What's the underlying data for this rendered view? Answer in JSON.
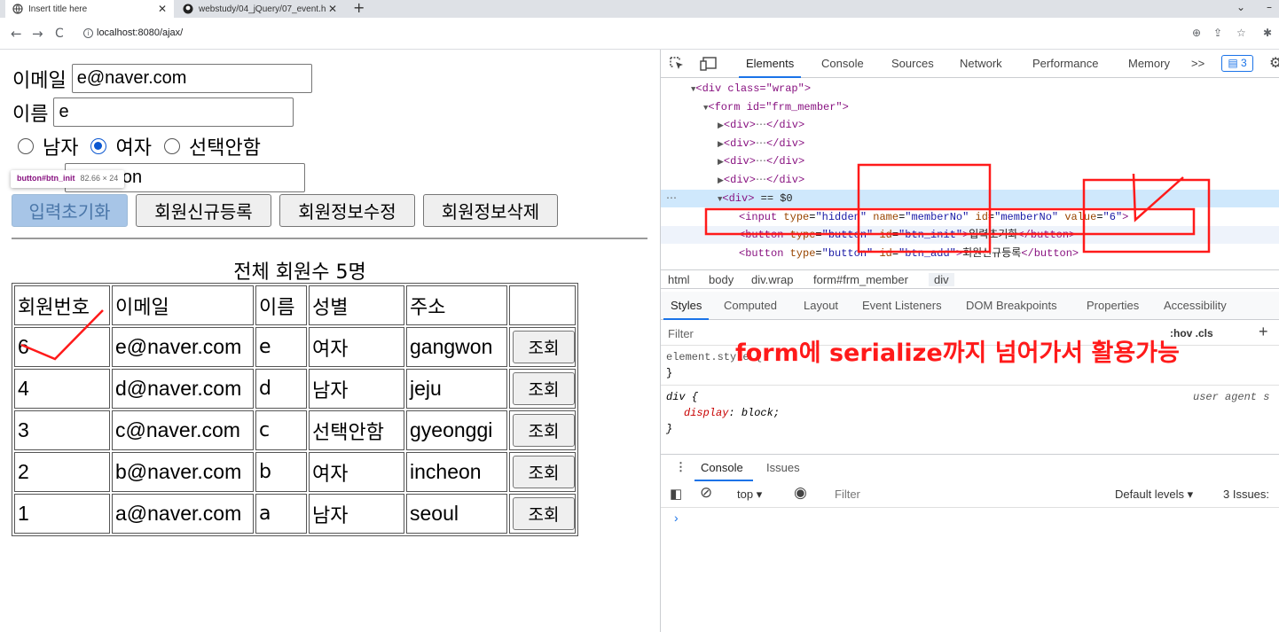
{
  "browser": {
    "tabs": [
      {
        "title": "Insert title here"
      },
      {
        "title": "webstudy/04_jQuery/07_event.h"
      }
    ],
    "new_tab": "+",
    "url": "localhost:8080/ajax/"
  },
  "form": {
    "email_label": "이메일",
    "email_value": "e@naver.com",
    "name_label": "이름",
    "name_value": "e",
    "genders": [
      "남자",
      "여자",
      "선택안함"
    ],
    "selected_gender": "여자",
    "address_value": "gangwon",
    "buttons": [
      "입력초기화",
      "회원신규등록",
      "회원정보수정",
      "회원정보삭제"
    ],
    "tooltip_selector": "button#btn_init",
    "tooltip_size": "82.66 × 24"
  },
  "table": {
    "caption": "전체 회원수 5명",
    "headers": [
      "회원번호",
      "이메일",
      "이름",
      "성별",
      "주소",
      ""
    ],
    "lookup_label": "조회",
    "rows": [
      [
        "6",
        "e@naver.com",
        "e",
        "여자",
        "gangwon"
      ],
      [
        "4",
        "d@naver.com",
        "d",
        "남자",
        "jeju"
      ],
      [
        "3",
        "c@naver.com",
        "c",
        "선택안함",
        "gyeonggi"
      ],
      [
        "2",
        "b@naver.com",
        "b",
        "여자",
        "incheon"
      ],
      [
        "1",
        "a@naver.com",
        "a",
        "남자",
        "seoul"
      ]
    ]
  },
  "devtools": {
    "tabs": [
      "Elements",
      "Console",
      "Sources",
      "Network",
      "Performance",
      "Memory"
    ],
    "more": ">>",
    "badge": "3",
    "dom": {
      "wrap_open": "<div class=\"wrap\">",
      "form_open": "<form id=\"frm_member\">",
      "div_collapsed": "<div>",
      "div_close": "</div>",
      "selected_div": "<div>",
      "selected_suffix": "== $0",
      "hidden_input": {
        "type": "hidden",
        "name": "memberNo",
        "id": "memberNo",
        "value": "6"
      },
      "btn_init_text": "입력초기화",
      "btn_add_text": "회원신규등록"
    },
    "breadcrumbs": [
      "html",
      "body",
      "div.wrap",
      "form#frm_member",
      "div"
    ],
    "style_tabs": [
      "Styles",
      "Computed",
      "Layout",
      "Event Listeners",
      "DOM Breakpoints",
      "Properties",
      "Accessibility"
    ],
    "filter_placeholder": "Filter",
    "hov_cls": ":hov .cls",
    "element_style": "element.style {",
    "rule_selector": "div {",
    "rule_source": "user agent s",
    "rule_prop": "display",
    "rule_value": "block;",
    "console_tabs": [
      "Console",
      "Issues"
    ],
    "console_context": "top",
    "console_filter": "Filter",
    "default_levels": "Default levels",
    "issues": "3 Issues:"
  },
  "annotation": {
    "text": "form에 serialize까지 넘어가서 활용가능",
    "color": "#ff1a1a"
  }
}
